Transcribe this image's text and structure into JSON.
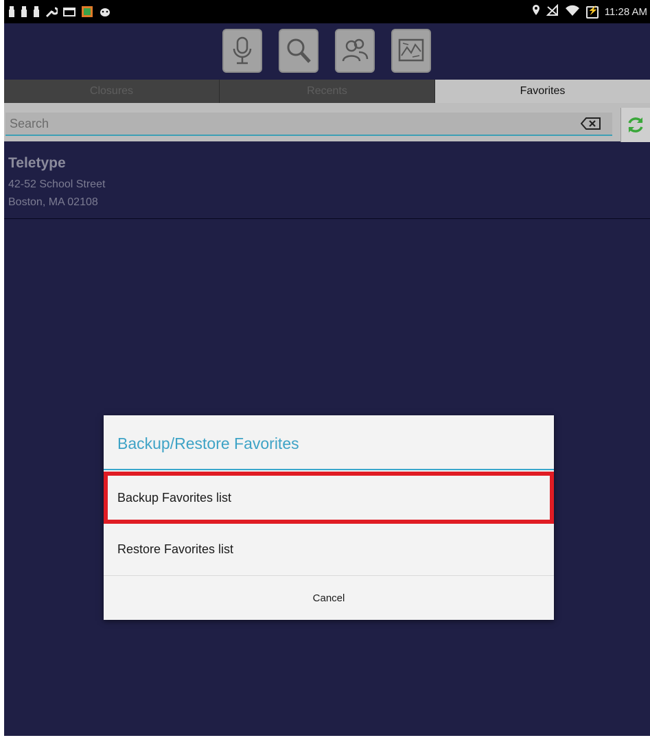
{
  "status_bar": {
    "left_icons": [
      "usb-icon",
      "usb-icon",
      "usb-icon",
      "wrench-icon",
      "tablet-icon",
      "store-icon",
      "android-icon"
    ],
    "right_icons": [
      "location-icon",
      "signal-off-icon",
      "wifi-icon",
      "battery-charging-icon"
    ],
    "time": "11:28 AM"
  },
  "toolbar": {
    "buttons": [
      "microphone-icon",
      "magnifier-icon",
      "contacts-icon",
      "map-icon"
    ]
  },
  "tabs": {
    "items": [
      {
        "label": "Closures",
        "active": false
      },
      {
        "label": "Recents",
        "active": false
      },
      {
        "label": "Favorites",
        "active": true
      }
    ]
  },
  "search": {
    "placeholder": "Search"
  },
  "favorites": {
    "items": [
      {
        "name": "Teletype",
        "line1": "42-52 School Street",
        "line2": "Boston, MA 02108"
      }
    ]
  },
  "dialog": {
    "title": "Backup/Restore Favorites",
    "options": [
      "Backup Favorites list",
      "Restore Favorites list"
    ],
    "cancel_label": "Cancel",
    "highlight_color": "#e01c24",
    "accent_color": "#3ea3c6"
  }
}
